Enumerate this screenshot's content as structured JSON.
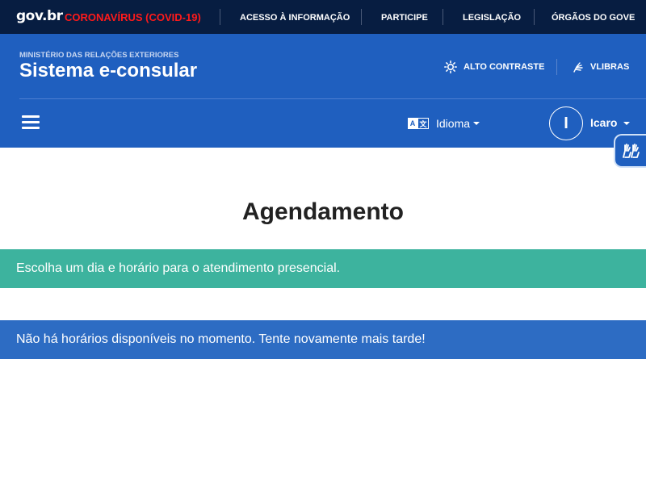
{
  "govbar": {
    "logo": "gov.br",
    "covid": "CORONAVÍRUS (COVID-19)",
    "links": [
      "ACESSO À INFORMAÇÃO",
      "PARTICIPE",
      "LEGISLAÇÃO",
      "ÓRGÃOS DO GOVE"
    ]
  },
  "header": {
    "ministry": "MINISTÉRIO DAS RELAÇÕES EXTERIORES",
    "title": "Sistema e-consular",
    "contrast_label": "ALTO CONTRASTE",
    "vlibras_label": "VLIBRAS",
    "language_label": "Idioma",
    "language_icon_left": "A",
    "language_icon_right": "文",
    "user_initial": "I",
    "user_name": "Icaro"
  },
  "main": {
    "title": "Agendamento",
    "info_message": "Escolha um dia e horário para o atendimento presencial.",
    "warning_message": "Não há horários disponíveis no momento. Tente novamente mais tarde!"
  },
  "icons": {
    "contrast": "sun-icon",
    "vlibras": "sign-language-icon",
    "menu": "hamburger-icon",
    "language": "translate-icon",
    "widget": "hands-icon"
  },
  "colors": {
    "govbar_bg": "#071d41",
    "covid_red": "#ff1a1a",
    "header_blue": "#1f5fbf",
    "info_green": "#3db39e",
    "warning_blue": "#2d6cc3"
  }
}
